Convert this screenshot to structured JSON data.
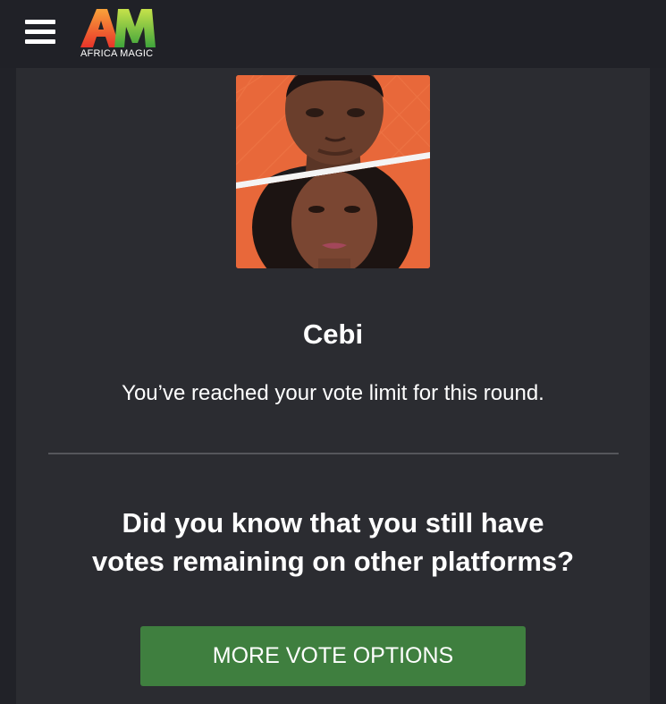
{
  "header": {
    "menu_icon": "hamburger-menu-icon",
    "logo_monogram": "AM",
    "logo_text": "AFRICA MAGIC",
    "colors": {
      "background": "#202127",
      "logo_orange": "#f2562a",
      "logo_green": "#6cc24a"
    }
  },
  "vote_card": {
    "housemate_photo": "housemate-pair-photo",
    "housemate_name": "Cebi",
    "vote_limit_message": "You’ve reached your vote limit for this round.",
    "question_line1": "Did you know that you still have",
    "question_line2": "votes remaining on other platforms?",
    "button_label": "MORE VOTE OPTIONS",
    "colors": {
      "card": "#2b2c31",
      "button": "#3f7f3f",
      "photo_background": "#e8683a"
    }
  }
}
